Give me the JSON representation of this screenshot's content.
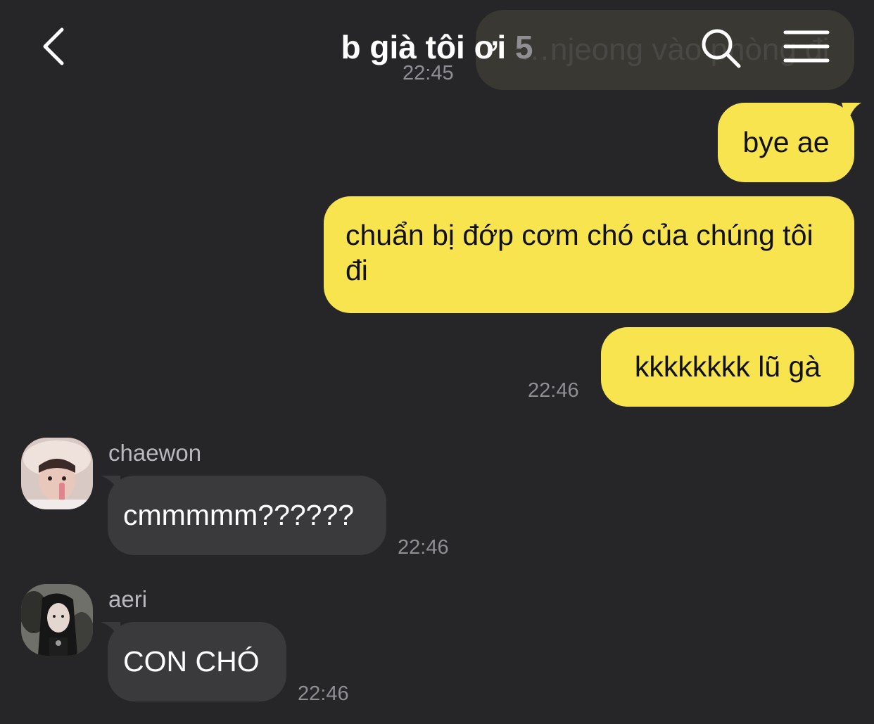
{
  "header": {
    "title": "b già tôi ơi",
    "member_count": "5",
    "back_icon": "chevron-left-icon",
    "search_icon": "search-icon",
    "menu_icon": "hamburger-menu-icon"
  },
  "previous": {
    "text": "…njeong vào phòng đi",
    "time": "22:45"
  },
  "outgoing": [
    {
      "text": "bye ae"
    },
    {
      "text": "chuẩn bị đớp cơm chó của chúng tôi đi"
    },
    {
      "text": "kkkkkkkk lũ gà"
    }
  ],
  "outgoing_time": "22:46",
  "incoming": [
    {
      "sender": "chaewon",
      "text": "cmmmmm??????",
      "time": "22:46",
      "avatar": "avatar-chaewon"
    },
    {
      "sender": "aeri",
      "text": "CON CHÓ",
      "time": "22:46",
      "avatar": "avatar-aeri"
    }
  ],
  "colors": {
    "background": "#262629",
    "outgoing_bubble": "#f8e44e",
    "incoming_bubble": "#3a3a3d",
    "timestamp": "#8e8e93"
  }
}
